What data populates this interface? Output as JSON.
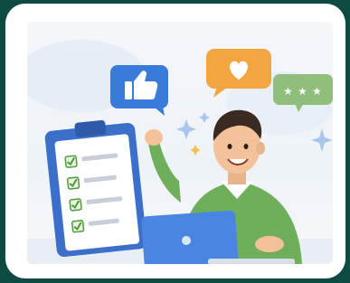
{
  "illustration": {
    "subject": "person-with-checklist-and-laptop",
    "icons": [
      "thumbs-up-icon",
      "heart-icon",
      "stars-icon",
      "sparkle-icon"
    ],
    "rating_stars": 3,
    "checklist_checked_items": 4,
    "colors": {
      "background": "#0d4a42",
      "frame": "#ffffff",
      "thumbs_bubble": "#3a7ad9",
      "heart_bubble": "#f2a541",
      "stars_bubble": "#8fbf7a",
      "sweater": "#6fae5a",
      "clipboard": "#3b6fc9",
      "laptop": "#4a86e0",
      "check": "#4e9a3c"
    }
  }
}
